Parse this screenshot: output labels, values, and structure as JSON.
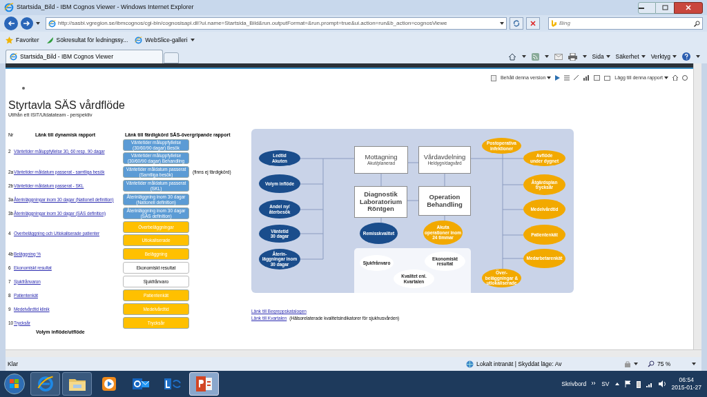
{
  "window": {
    "title": "Startsida_Bild - IBM Cognos Viewer - Windows Internet Explorer"
  },
  "address_bar": {
    "url": "http://sasbi.vgregion.se/ibmcognos/cgi-bin/cognosisapi.dll?ui.name=Startsida_Bild&run.outputFormat=&run.prompt=true&ui.action=run&b_action=cognosViewe",
    "search_placeholder": "Bing"
  },
  "favorites_bar": {
    "items": [
      "Favoriter",
      "Sökresultat för ledningssy...",
      "WebSlice-galleri"
    ]
  },
  "tab": {
    "title": "Startsida_Bild - IBM Cognos Viewer"
  },
  "command_bar": [
    "Sida",
    "Säkerhet",
    "Verktyg"
  ],
  "report_toolbar": {
    "keep_version": "Behåll denna version",
    "add_report": "Lägg till denna rapport"
  },
  "report": {
    "title": "Styrtavla SÄS vårdflöde",
    "subtitle": "Utifrån ett ISIT/Utdatateam - perspektiv",
    "columns": [
      "Nr",
      "Länk till dynamisk rapport",
      "Länk till färdigkörd SÄS-övergripande rapport"
    ],
    "rows": [
      {
        "nr": "2",
        "link": "Väntetider måluppfyllelse 30, 60 resp. 90 dagar",
        "buttons": [
          {
            "label": "Väntetider måluppfyllelse (30/60/90 dagar) Besök",
            "kind": "filled",
            "color": "#5b9bd5"
          },
          {
            "label": "Väntetider måluppfyllelse (30/60/90 dagar) Behandling",
            "kind": "filled",
            "color": "#5b9bd5"
          }
        ]
      },
      {
        "nr": "2a",
        "link": "Väntetider måldatum passerat - samtliga besök",
        "buttons": [
          {
            "label": "Väntetider måldatum passerat (Samtliga besök)",
            "kind": "filled",
            "color": "#5b9bd5"
          }
        ],
        "note": "(finns ej färdigkörd)"
      },
      {
        "nr": "2b",
        "link": "Väntetider måldatum passerat - SKL",
        "buttons": [
          {
            "label": "Väntetider måldatum passerat (SKL)",
            "kind": "filled",
            "color": "#5b9bd5"
          }
        ]
      },
      {
        "nr": "3a",
        "link": "Återinläggningar inom 30 dagar (Nationell definition)",
        "buttons": [
          {
            "label": "Återinläggning inom 30 dagar (Nationell definition)",
            "kind": "filled",
            "color": "#5b9bd5"
          }
        ]
      },
      {
        "nr": "3b",
        "link": "Återinläggningar inom 30 dagar (SÄS definition)",
        "buttons": [
          {
            "label": "Återinläggning inom 30 dagar (SÄS definition)",
            "kind": "filled",
            "color": "#5b9bd5"
          }
        ]
      },
      {
        "nr": "4",
        "link": "Överbeläggning och Utlokaliserade patienter",
        "buttons": [
          {
            "label": "Överbeläggningar",
            "kind": "filled",
            "color": "#ffc000"
          },
          {
            "label": "Utlokaliserade",
            "kind": "filled",
            "color": "#ffc000"
          }
        ]
      },
      {
        "nr": "4b",
        "link": "Beläggning %",
        "buttons": [
          {
            "label": "Beläggning",
            "kind": "filled",
            "color": "#ffc000"
          }
        ]
      },
      {
        "nr": "6",
        "link": "Ekonomiskt resultat",
        "buttons": [
          {
            "label": "Ekonomiskt resultat",
            "kind": "outline"
          }
        ]
      },
      {
        "nr": "7",
        "link": "Sjukfrånvaron",
        "buttons": [
          {
            "label": "Sjukfrånvaro",
            "kind": "outline"
          }
        ]
      },
      {
        "nr": "8",
        "link": "Patientenkät",
        "buttons": [
          {
            "label": "Patientenkät",
            "kind": "filled",
            "color": "#ffc000"
          }
        ]
      },
      {
        "nr": "9",
        "link": "Medelvårdtid klinik",
        "buttons": [
          {
            "label": "Medelvårdtid",
            "kind": "filled",
            "color": "#ffc000"
          }
        ]
      },
      {
        "nr": "10",
        "link": "Trycksår",
        "buttons": [
          {
            "label": "Trycksår",
            "kind": "filled",
            "color": "#ffc000"
          }
        ]
      }
    ],
    "section_heading": "Volym inflöde/utflöde"
  },
  "diagram": {
    "left_indicators": [
      "Ledtid\nAkuten",
      "Volym inflöde",
      "Andel ny/\nåterbesök",
      "Väntetid\n30 dagar",
      "Återin-\nläggningar inom\n30 dagar"
    ],
    "process_boxes": [
      {
        "title": "Mottagning",
        "subtitle": "Akut/planerad"
      },
      {
        "title": "Vårdavdelning",
        "subtitle": "Heldygn/dagvård"
      },
      {
        "title": "Diagnostik\nLaboratorium\nRöntgen"
      },
      {
        "title": "Operation\nBehandling"
      }
    ],
    "process_indicators": [
      {
        "label": "Remisskvalitet",
        "color": "#1a4d8c"
      },
      {
        "label": "Akuta\noperationer inom\n24 timmar",
        "color": "#f2a900"
      }
    ],
    "panel_indicators": [
      "Sjukfrånvaro",
      "Ekonomiskt\nresultat",
      "Kvalitet enl.\nKvartalen"
    ],
    "right_indicators": [
      "Postoperativa\ninfektioner",
      "Avflöde\nunder dygnet",
      "Åtgärdsplan\ntrycksår",
      "Medelvårdtid",
      "Patientenkät",
      "Medarbetarenkät",
      "Över-\nbeläggningar &\nutlokaliserade"
    ]
  },
  "links": [
    {
      "label": "Länk till Begreppskatalogen"
    },
    {
      "label": "Länk till Kvartalen",
      "note": "(Hälsorelaterade kvalitetsindikatorer för sjukhusvården)"
    }
  ],
  "status_bar": {
    "text": "Klar",
    "zone": "Lokalt intranät | Skyddat läge: Av",
    "zoom": "75 %"
  },
  "taskbar": {
    "apps": [
      {
        "kind": "browser",
        "selected": false
      },
      {
        "kind": "folder",
        "selected": false
      },
      {
        "kind": "media",
        "selected": false
      },
      {
        "kind": "mail",
        "selected": false
      },
      {
        "kind": "chat",
        "selected": false
      },
      {
        "kind": "slides",
        "selected": true
      }
    ],
    "toolbar": "Skrivbord",
    "language": "SV",
    "time": "06:54",
    "date": "2015-01-27"
  }
}
